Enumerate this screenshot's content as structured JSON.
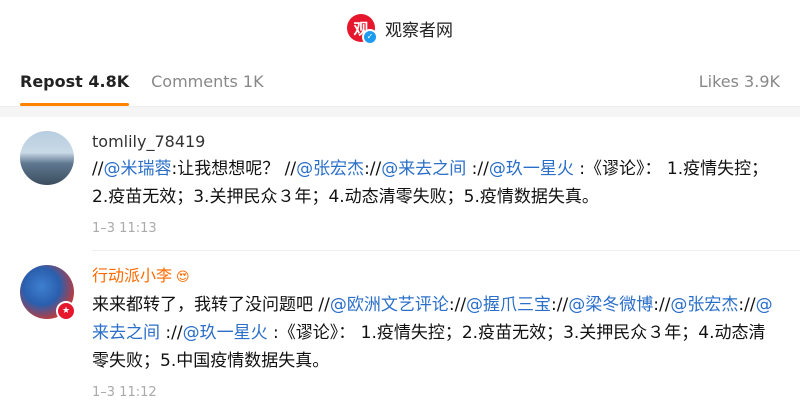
{
  "header": {
    "logo_text": "观",
    "title": "观察者网"
  },
  "tabs": [
    {
      "label": "Repost 4.8K",
      "active": true
    },
    {
      "label": "Comments 1K",
      "active": false
    },
    {
      "label": "Likes 3.9K",
      "active": false
    }
  ],
  "posts": [
    {
      "username": "tomlily_78419",
      "segments": [
        {
          "t": "//",
          "m": false
        },
        {
          "t": "@米瑞蓉",
          "m": true
        },
        {
          "t": ":让我想想呢？ //",
          "m": false
        },
        {
          "t": "@张宏杰",
          "m": true
        },
        {
          "t": "://",
          "m": false
        },
        {
          "t": "@来去之间",
          "m": true
        },
        {
          "t": " ://",
          "m": false
        },
        {
          "t": "@玖一星火",
          "m": true
        },
        {
          "t": " :《谬论》： 1.疫情失控；2.疫苗无效；3.关押民众３年；4.动态清零失败；5.疫情数据失真。",
          "m": false
        }
      ],
      "time": "1–3 11:13"
    },
    {
      "username": "行动派小李",
      "username_emoji": "😍",
      "segments": [
        {
          "t": "来来都转了，我转了没问题吧 //",
          "m": false
        },
        {
          "t": "@欧洲文艺评论",
          "m": true
        },
        {
          "t": "://",
          "m": false
        },
        {
          "t": "@握爪三宝",
          "m": true
        },
        {
          "t": "://",
          "m": false
        },
        {
          "t": "@梁冬微博",
          "m": true
        },
        {
          "t": "://",
          "m": false
        },
        {
          "t": "@张宏杰",
          "m": true
        },
        {
          "t": "://",
          "m": false
        },
        {
          "t": "@来去之间",
          "m": true
        },
        {
          "t": " ://",
          "m": false
        },
        {
          "t": "@玖一星火",
          "m": true
        },
        {
          "t": " :《谬论》： 1.疫情失控；2.疫苗无效；3.关押民众３年；4.动态清零失败；5.中国疫情数据失真。",
          "m": false
        }
      ],
      "time": "1–3 11:12"
    }
  ],
  "colors": {
    "accent": "#ff8200",
    "mention": "#2b6fc9",
    "brand": "#e6162d"
  }
}
